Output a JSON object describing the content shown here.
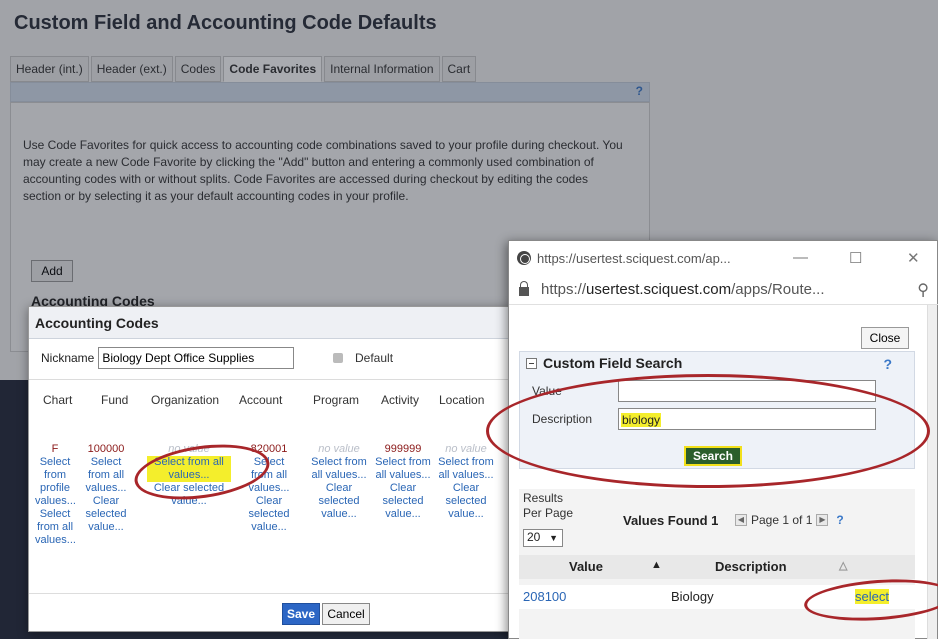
{
  "page": {
    "title": "Custom Field and Accounting Code Defaults",
    "tabs": [
      "Header (int.)",
      "Header (ext.)",
      "Codes",
      "Code Favorites",
      "Internal Information",
      "Cart"
    ],
    "active_tab": "Code Favorites",
    "help": "?",
    "intro": "Use Code Favorites for quick access to accounting code combinations saved to your profile during checkout. You may create a new Code Favorite by clicking the \"Add\" button and entering a commonly used combination of accounting codes with or without splits. Code Favorites are accessed during checkout by editing the codes section or by selecting it as your default accounting codes in your profile.",
    "add_label": "Add",
    "accounting_heading": "Accounting Codes"
  },
  "dialog": {
    "title": "Accounting Codes",
    "nickname_label": "Nickname",
    "nickname_value": "Biology Dept Office Supplies",
    "default_label": "Default",
    "columns": [
      {
        "header": "Chart",
        "value": "F",
        "lines": [
          "Select from profile values...",
          "Select from all values..."
        ]
      },
      {
        "header": "Fund",
        "value": "100000",
        "lines": [
          "Select from all values...",
          "Clear selected value..."
        ]
      },
      {
        "header": "Organization",
        "value": "no value",
        "lines": [
          "Select from all values...",
          "Clear selected value..."
        ]
      },
      {
        "header": "Account",
        "value": "820001",
        "lines": [
          "Select from all values...",
          "Clear selected value..."
        ]
      },
      {
        "header": "Program",
        "value": "no value",
        "lines": [
          "Select from all values...",
          "Clear selected value..."
        ]
      },
      {
        "header": "Activity",
        "value": "999999",
        "lines": [
          "Select from all values...",
          "Clear selected value..."
        ]
      },
      {
        "header": "Location",
        "value": "no value",
        "lines": [
          "Select from all values...",
          "Clear selected value..."
        ]
      }
    ],
    "save_label": "Save",
    "cancel_label": "Cancel"
  },
  "popup": {
    "tab_url": "https://usertest.sciquest.com/ap...",
    "minimize": "—",
    "maximize": "☐",
    "close_x": "✕",
    "address_prefix": "https://",
    "address_host": "usertest.sciquest.com",
    "address_rest": "/apps/Route...",
    "zoom_icon": "⚲",
    "close_label": "Close",
    "search_title": "Custom Field Search",
    "help": "?",
    "value_label": "Value",
    "value_input": "",
    "description_label": "Description",
    "description_input": "biology",
    "search_label": "Search",
    "results_per_page_label": "Results Per Page",
    "results_per_page_value": "20",
    "values_found": "Values Found 1",
    "page_text": "Page 1 of 1",
    "col_value": "Value",
    "col_description": "Description",
    "rows": [
      {
        "value": "208100",
        "description": "Biology",
        "action": "select"
      }
    ]
  },
  "colors": {
    "highlight": "#f4ee2c",
    "annotation_ring": "#a8262a",
    "link": "#2a66b5"
  }
}
